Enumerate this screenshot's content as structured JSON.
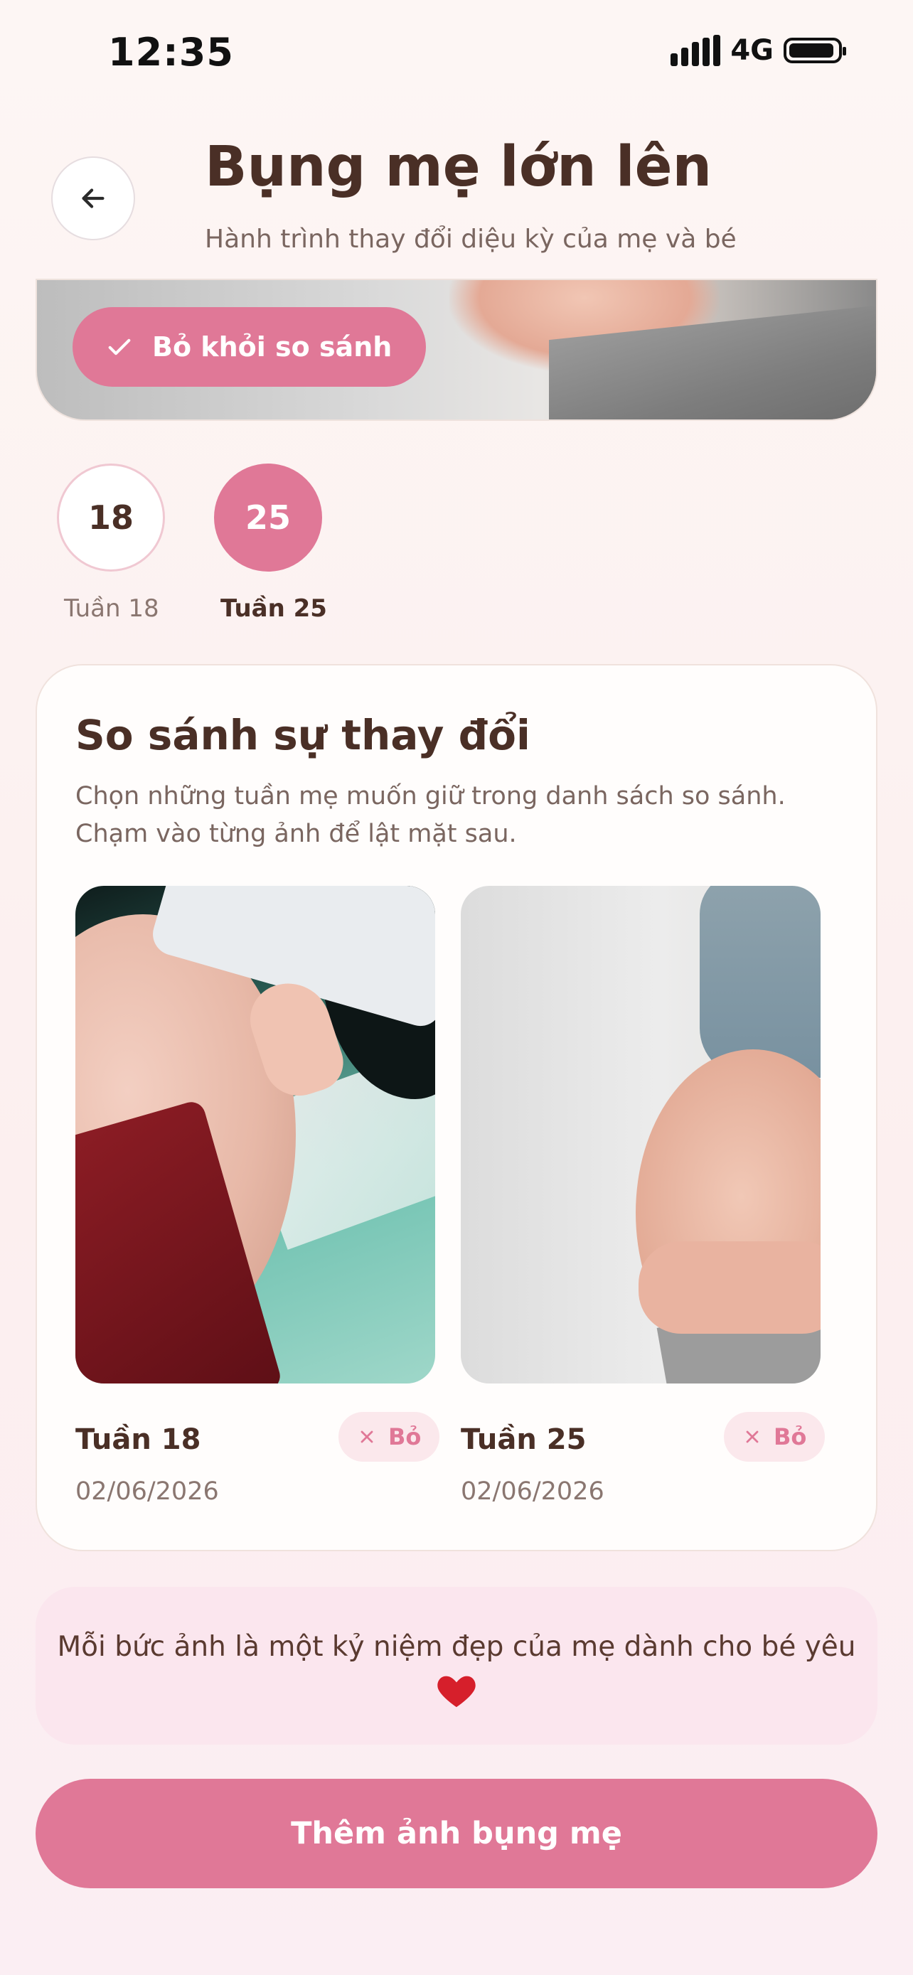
{
  "status_bar": {
    "time": "12:35",
    "network": "4G",
    "signal_icon": "signal-bars-icon",
    "battery_icon": "battery-icon"
  },
  "header": {
    "back_icon": "arrow-left-icon",
    "title": "Bụng mẹ lớn lên",
    "subtitle": "Hành trình thay đổi diệu kỳ của mẹ và bé"
  },
  "featured": {
    "remove_compare_label": "Bỏ khỏi so sánh",
    "check_icon": "check-icon"
  },
  "weeks": [
    {
      "number": "18",
      "label": "Tuần 18",
      "selected": false
    },
    {
      "number": "25",
      "label": "Tuần 25",
      "selected": true
    }
  ],
  "compare": {
    "title": "So sánh sự thay đổi",
    "description": "Chọn những tuần mẹ muốn giữ trong danh sách so sánh. Chạm vào từng ảnh để lật mặt sau.",
    "photos": [
      {
        "week": "Tuần 18",
        "date": "02/06/2026",
        "remove_label": "Bỏ"
      },
      {
        "week": "Tuần 25",
        "date": "02/06/2026",
        "remove_label": "Bỏ"
      }
    ]
  },
  "note": {
    "text": "Mỗi bức ảnh là một kỷ niệm đẹp của mẹ dành cho bé yêu",
    "icon": "heart-icon"
  },
  "add_button": {
    "label": "Thêm ảnh bụng mẹ"
  },
  "colors": {
    "accent": "#e07897",
    "text_dark": "#4a2f26",
    "text_muted": "#7a6660",
    "note_bg": "#fbe6ee",
    "chip_bg": "#fbe8ec"
  }
}
